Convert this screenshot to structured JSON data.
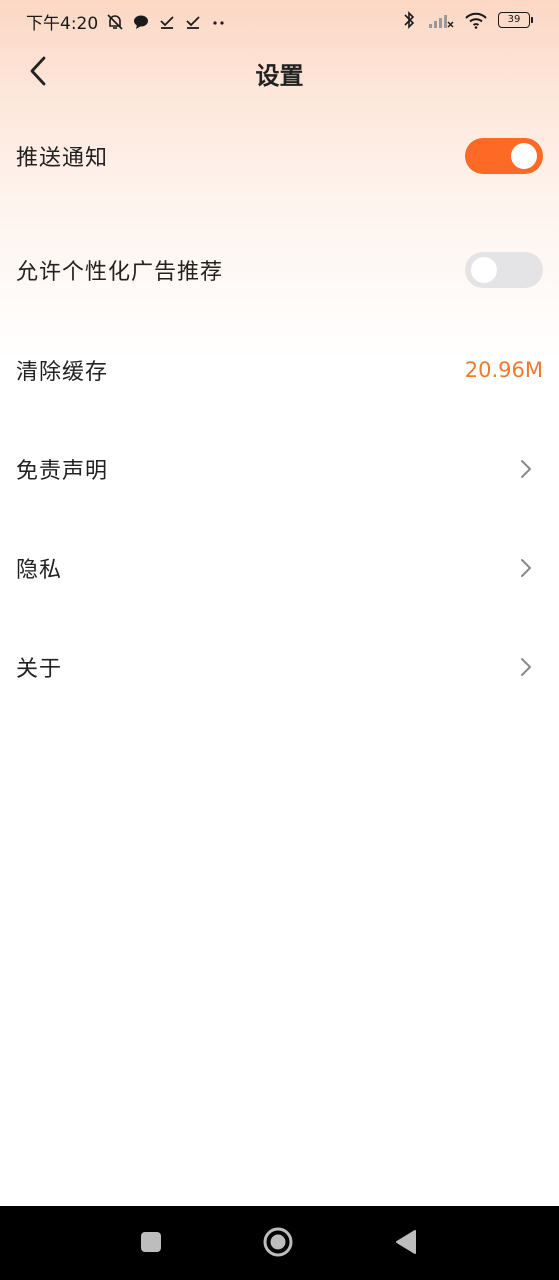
{
  "status_bar": {
    "time": "下午4:20",
    "icons_left": [
      "bell-off-icon",
      "chat-bubble-icon",
      "check-icon",
      "check-icon",
      "more-dots-icon"
    ],
    "icons_right": [
      "bluetooth-icon",
      "cell-signal-icon",
      "wifi-icon",
      "battery-icon"
    ],
    "battery": "39"
  },
  "header": {
    "title": "设置",
    "back_icon": "chevron-left-icon"
  },
  "settings": {
    "push_label": "推送通知",
    "push_enabled": true,
    "ads_label": "允许个性化广告推荐",
    "ads_enabled": false,
    "cache_label": "清除缓存",
    "cache_value": "20.96M",
    "disclaimer_label": "免责声明",
    "privacy_label": "隐私",
    "about_label": "关于"
  },
  "colors": {
    "accent": "#fc6a25",
    "cache_value": "#f07a2c",
    "toggle_off": "#e4e4e6",
    "header_gradient_top": "#fcd7c4",
    "nav_bar": "#000000"
  },
  "nav_bar": {
    "icons": [
      "square-icon",
      "circle-home-icon",
      "triangle-back-icon"
    ]
  }
}
